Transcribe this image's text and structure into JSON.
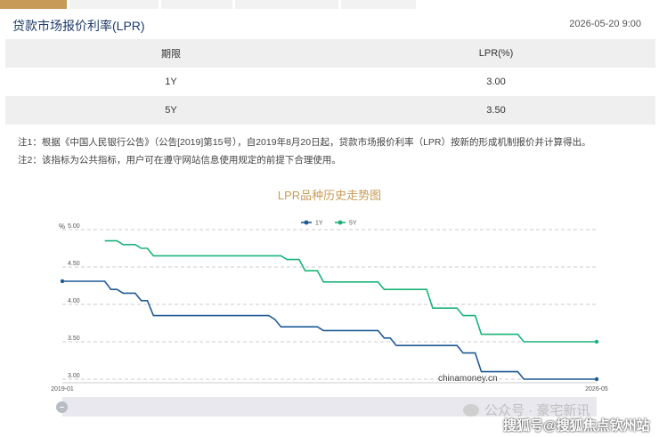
{
  "header": {
    "title": "贷款市场报价利率(LPR)",
    "timestamp": "2026-05-20 9:00"
  },
  "table": {
    "headers": [
      "期限",
      "LPR(%)"
    ],
    "rows": [
      [
        "1Y",
        "3.00"
      ],
      [
        "5Y",
        "3.50"
      ]
    ]
  },
  "notes": [
    "注1：根据《中国人民银行公告》（公告[2019]第15号），自2019年8月20日起，贷款市场报价利率（LPR）按新的形成机制报价并计算得出。",
    "注2：该指标为公共指标，用户可在遵守网站信息使用规定的前提下合理使用。"
  ],
  "chart_data": {
    "type": "line",
    "title": "LPR品种历史走势图",
    "y_unit_label": "%",
    "ylim": [
      3.0,
      5.0
    ],
    "y_ticks": [
      "5.00",
      "4.50",
      "4.00",
      "3.50",
      "3.00"
    ],
    "x_ticks": [
      "2019-01",
      "2026-05"
    ],
    "xlim": [
      "2019-01",
      "2026-05"
    ],
    "grid": true,
    "legend_position": "top-center",
    "watermark": "chinamoney.cn",
    "series": [
      {
        "name": "1Y",
        "color": "#1f5a96",
        "points": [
          [
            "2019-01",
            4.31
          ],
          [
            "2019-08",
            4.31
          ],
          [
            "2019-09",
            4.2
          ],
          [
            "2019-10",
            4.2
          ],
          [
            "2019-11",
            4.15
          ],
          [
            "2020-01",
            4.15
          ],
          [
            "2020-02",
            4.05
          ],
          [
            "2020-03",
            4.05
          ],
          [
            "2020-04",
            3.85
          ],
          [
            "2021-11",
            3.85
          ],
          [
            "2021-12",
            3.8
          ],
          [
            "2022-01",
            3.7
          ],
          [
            "2022-07",
            3.7
          ],
          [
            "2022-08",
            3.65
          ],
          [
            "2023-05",
            3.65
          ],
          [
            "2023-06",
            3.55
          ],
          [
            "2023-07",
            3.55
          ],
          [
            "2023-08",
            3.45
          ],
          [
            "2024-06",
            3.45
          ],
          [
            "2024-07",
            3.35
          ],
          [
            "2024-09",
            3.35
          ],
          [
            "2024-10",
            3.1
          ],
          [
            "2025-04",
            3.1
          ],
          [
            "2025-05",
            3.0
          ],
          [
            "2026-05",
            3.0
          ]
        ]
      },
      {
        "name": "5Y",
        "color": "#1bb37a",
        "points": [
          [
            "2019-08",
            4.85
          ],
          [
            "2019-10",
            4.85
          ],
          [
            "2019-11",
            4.8
          ],
          [
            "2020-01",
            4.8
          ],
          [
            "2020-02",
            4.75
          ],
          [
            "2020-03",
            4.75
          ],
          [
            "2020-04",
            4.65
          ],
          [
            "2022-01",
            4.65
          ],
          [
            "2022-02",
            4.6
          ],
          [
            "2022-04",
            4.6
          ],
          [
            "2022-05",
            4.45
          ],
          [
            "2022-07",
            4.45
          ],
          [
            "2022-08",
            4.3
          ],
          [
            "2023-05",
            4.3
          ],
          [
            "2023-06",
            4.2
          ],
          [
            "2024-01",
            4.2
          ],
          [
            "2024-02",
            3.95
          ],
          [
            "2024-06",
            3.95
          ],
          [
            "2024-07",
            3.85
          ],
          [
            "2024-09",
            3.85
          ],
          [
            "2024-10",
            3.6
          ],
          [
            "2025-04",
            3.6
          ],
          [
            "2025-05",
            3.5
          ],
          [
            "2026-05",
            3.5
          ]
        ]
      }
    ]
  },
  "watermarks": {
    "line1": "公众号 · 豪宅新讯",
    "line2": "搜狐号@搜狐焦点钦州站"
  }
}
